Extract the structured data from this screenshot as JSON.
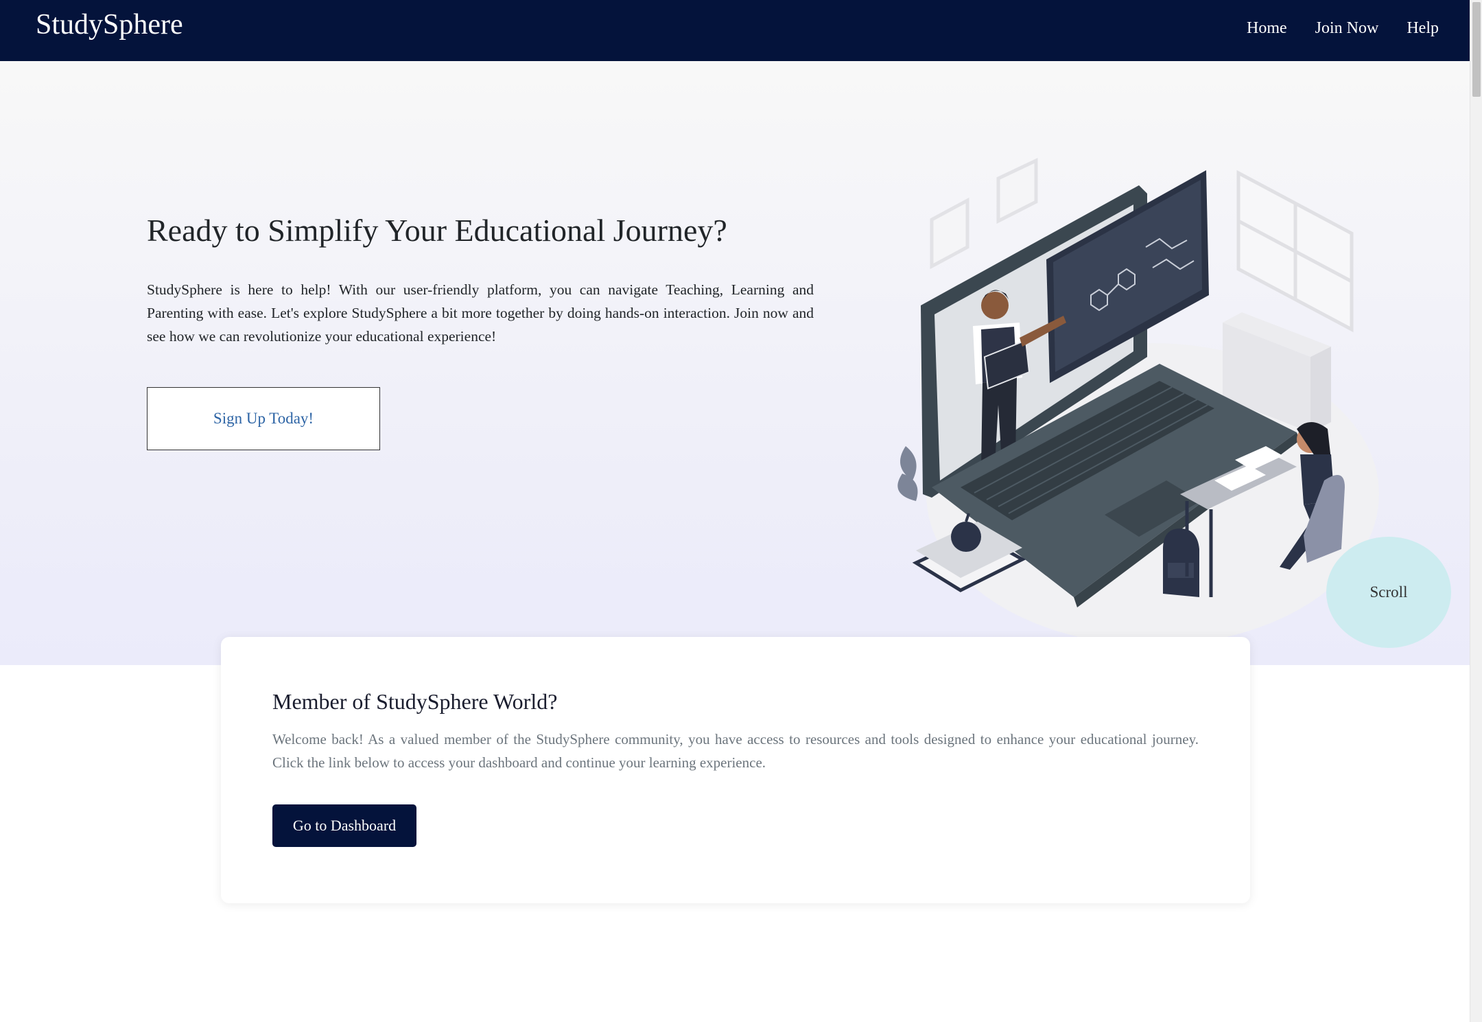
{
  "navbar": {
    "brand": "StudySphere",
    "links": [
      {
        "label": "Home"
      },
      {
        "label": "Join Now"
      },
      {
        "label": "Help"
      }
    ]
  },
  "hero": {
    "title": "Ready to Simplify Your Educational Journey?",
    "description": "StudySphere is here to help! With our user-friendly platform, you can navigate Teaching, Learning and Parenting with ease. Let's explore StudySphere a bit more together by doing hands-on interaction. Join now and see how we can revolutionize your educational experience!",
    "cta_label": "Sign Up Today!",
    "illustration": "online-teaching-illustration",
    "scroll_label": "Scroll"
  },
  "member": {
    "title": "Member of StudySphere World?",
    "description": "Welcome back! As a valued member of the StudySphere community, you have access to resources and tools designed to enhance your educational journey. Click the link below to access your dashboard and continue your learning experience.",
    "button_label": "Go to Dashboard"
  },
  "colors": {
    "navbar": "#04133b",
    "link_blue": "#2d64a5",
    "scroll_circle": "#cdecf0"
  }
}
